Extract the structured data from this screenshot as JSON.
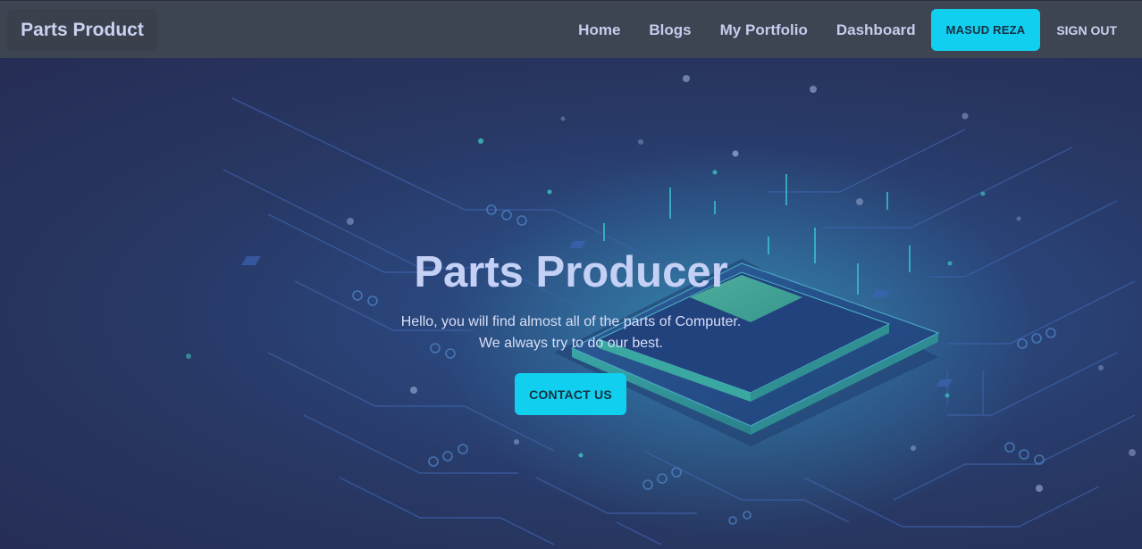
{
  "navbar": {
    "brand": "Parts Product",
    "links": [
      "Home",
      "Blogs",
      "My Portfolio",
      "Dashboard"
    ],
    "user_button": "MASUD REZA",
    "sign_out": "SIGN OUT"
  },
  "hero": {
    "title": "Parts Producer",
    "subtitle_line1": "Hello, you will find almost all of the parts of Computer.",
    "subtitle_line2": "We always try to do our best.",
    "cta_label": "CONTACT US"
  },
  "colors": {
    "navbar_bg": "#3d4452",
    "accent": "#11cfef",
    "hero_bg": "#27315a",
    "title_text": "#c4d0f5"
  },
  "icons": [
    "microchip-illustration"
  ]
}
